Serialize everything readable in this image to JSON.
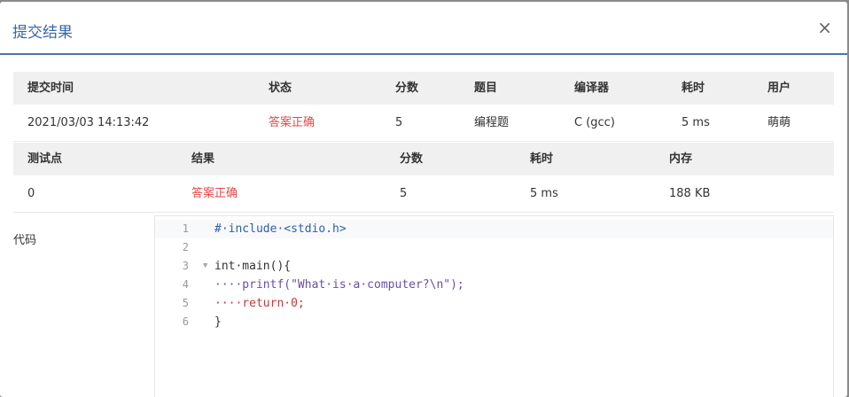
{
  "modal": {
    "title": "提交结果",
    "close": "×"
  },
  "summary": {
    "headers": [
      "提交时间",
      "状态",
      "分数",
      "题目",
      "编译器",
      "耗时",
      "用户"
    ],
    "row": [
      "2021/03/03 14:13:42",
      "答案正确",
      "5",
      "编程题",
      "C (gcc)",
      "5 ms",
      "萌萌"
    ]
  },
  "tests": {
    "headers": [
      "测试点",
      "结果",
      "分数",
      "耗时",
      "内存"
    ],
    "row": [
      "0",
      "答案正确",
      "5",
      "5 ms",
      "188 KB"
    ]
  },
  "code": {
    "label": "代码",
    "lines": [
      {
        "n": "1",
        "text": "#·include·<stdio.h>"
      },
      {
        "n": "2",
        "text": ""
      },
      {
        "n": "3",
        "text": "int·main(){"
      },
      {
        "n": "4",
        "text": "····printf(\"What·is·a·computer?\\n\");"
      },
      {
        "n": "5",
        "text": "····return·0;"
      },
      {
        "n": "6",
        "text": "}"
      }
    ]
  },
  "colors": {
    "accent": "#4a72ae",
    "success_text": "#e54848"
  }
}
